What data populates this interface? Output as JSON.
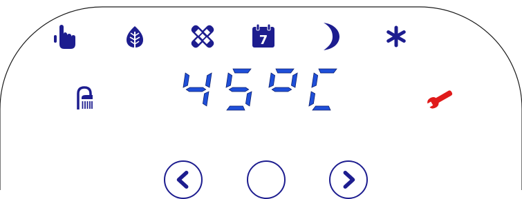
{
  "display": {
    "value": "45",
    "unit": "°C",
    "text": "45°C",
    "segment_color": "#1f4fd8"
  },
  "colors": {
    "icon": "#1d1d8f",
    "wrench": "#e01b1b",
    "outline": "#1a1a1a"
  },
  "mode_icons": [
    {
      "name": "hand-pointer-icon"
    },
    {
      "name": "leaf-icon"
    },
    {
      "name": "bandage-icon"
    },
    {
      "name": "calendar-icon",
      "day": "7"
    },
    {
      "name": "moon-icon"
    },
    {
      "name": "snowflake-icon"
    }
  ],
  "side_icons": {
    "left": "shower-icon",
    "right": "wrench-icon"
  },
  "buttons": [
    {
      "name": "prev-button",
      "icon": "chevron-left-icon"
    },
    {
      "name": "center-button",
      "icon": ""
    },
    {
      "name": "next-button",
      "icon": "chevron-right-icon"
    }
  ]
}
